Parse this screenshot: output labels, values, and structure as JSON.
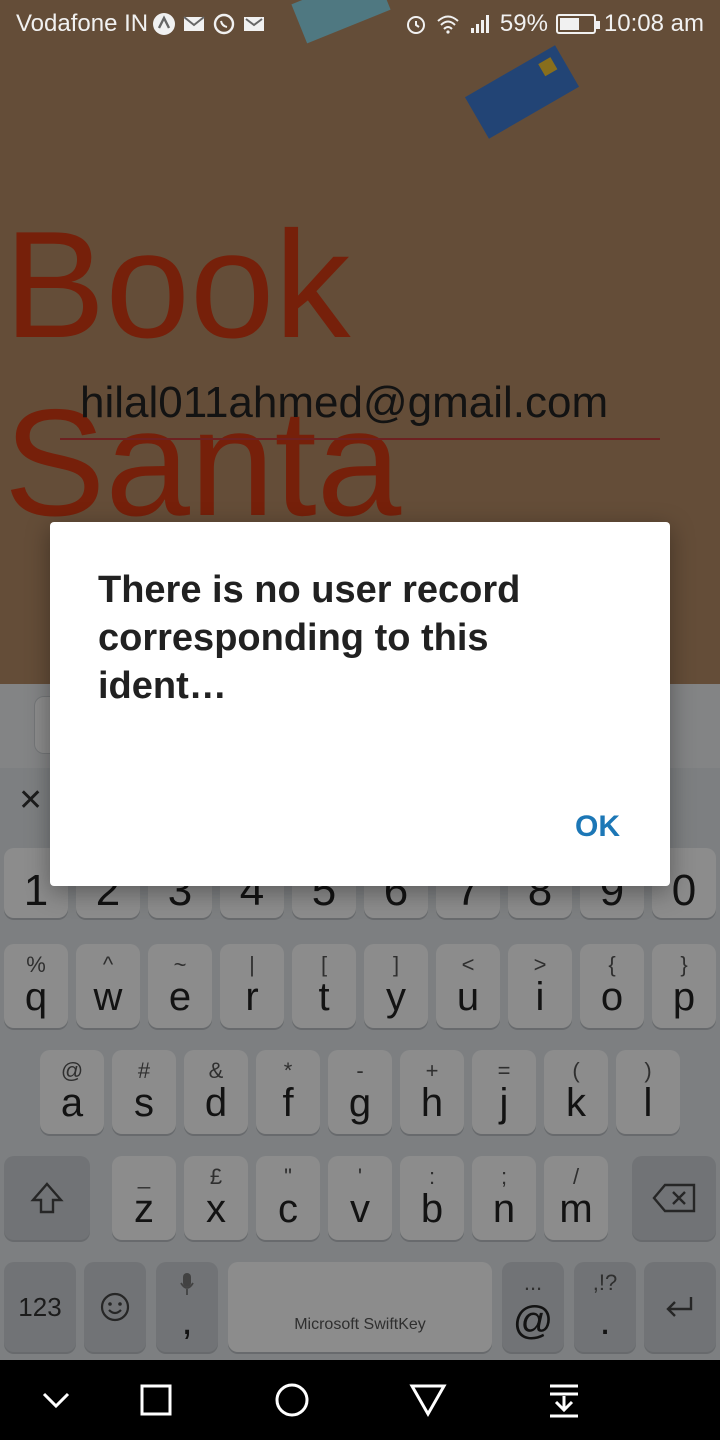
{
  "status_bar": {
    "carrier": "Vodafone IN",
    "battery_percent": "59%",
    "battery_level": 0.59,
    "time": "10:08 am",
    "icons_left": [
      "app-notification-icon",
      "gmail-icon",
      "whatsapp-icon",
      "mail-icon"
    ],
    "icons_right": [
      "alarm-icon",
      "wifi-icon",
      "signal-icon",
      "battery-icon"
    ]
  },
  "app": {
    "title_line1": "Book",
    "title_line2": "Santa",
    "email_value": "hilal011ahmed@gmail.com",
    "password_mask": "••••••"
  },
  "dialog": {
    "message": "There is no user record corresponding to this ident…",
    "ok_label": "OK"
  },
  "keyboard": {
    "brand_label": "Microsoft SwiftKey",
    "number_row": [
      "1",
      "2",
      "3",
      "4",
      "5",
      "6",
      "7",
      "8",
      "9",
      "0"
    ],
    "row1": [
      {
        "pri": "q",
        "sec": "%"
      },
      {
        "pri": "w",
        "sec": "^"
      },
      {
        "pri": "e",
        "sec": "~"
      },
      {
        "pri": "r",
        "sec": "|"
      },
      {
        "pri": "t",
        "sec": "["
      },
      {
        "pri": "y",
        "sec": "]"
      },
      {
        "pri": "u",
        "sec": "<"
      },
      {
        "pri": "i",
        "sec": ">"
      },
      {
        "pri": "o",
        "sec": "{"
      },
      {
        "pri": "p",
        "sec": "}"
      }
    ],
    "row2": [
      {
        "pri": "a",
        "sec": "@"
      },
      {
        "pri": "s",
        "sec": "#"
      },
      {
        "pri": "d",
        "sec": "&"
      },
      {
        "pri": "f",
        "sec": "*"
      },
      {
        "pri": "g",
        "sec": "-"
      },
      {
        "pri": "h",
        "sec": "+"
      },
      {
        "pri": "j",
        "sec": "="
      },
      {
        "pri": "k",
        "sec": "("
      },
      {
        "pri": "l",
        "sec": ")"
      }
    ],
    "row3": [
      {
        "pri": "z",
        "sec": "_"
      },
      {
        "pri": "x",
        "sec": "£"
      },
      {
        "pri": "c",
        "sec": "\""
      },
      {
        "pri": "v",
        "sec": "'"
      },
      {
        "pri": "b",
        "sec": ":"
      },
      {
        "pri": "n",
        "sec": ";"
      },
      {
        "pri": "m",
        "sec": "/"
      }
    ],
    "numbers_key": "123",
    "comma_key": ",",
    "at_key": "@",
    "period_key": ".",
    "period_key_sec": ",!?",
    "at_key_sec": "..."
  },
  "nav_bar": {
    "buttons": [
      "hide-keyboard",
      "recents",
      "home",
      "back",
      "notification-pull"
    ]
  }
}
